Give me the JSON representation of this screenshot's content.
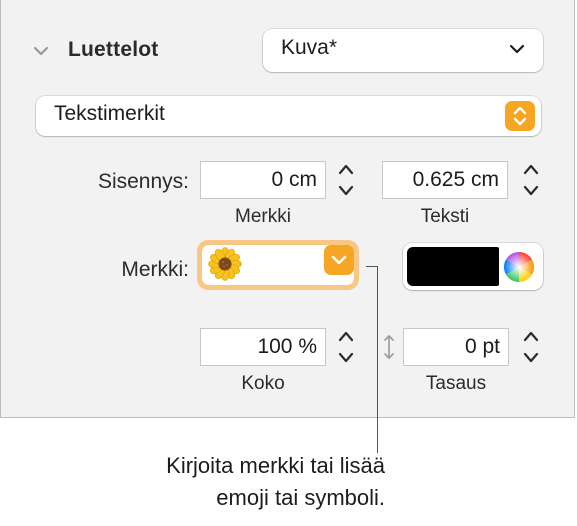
{
  "section": {
    "title": "Luettelot",
    "style_popup_value": "Kuva*"
  },
  "bullet_type": {
    "value": "Tekstimerkit"
  },
  "indent": {
    "label": "Sisennys:",
    "merkki_value": "0 cm",
    "merkki_sublabel": "Merkki",
    "teksti_value": "0.625 cm",
    "teksti_sublabel": "Teksti"
  },
  "bullet": {
    "label": "Merkki:",
    "character_icon": "sunflower-emoji",
    "color": "#000000"
  },
  "size": {
    "value": "100 %",
    "sublabel": "Koko"
  },
  "align": {
    "value": "0 pt",
    "sublabel": "Tasaus"
  },
  "callout": {
    "line1": "Kirjoita merkki tai lisää",
    "line2": "emoji tai symboli."
  },
  "colors": {
    "accent": "#f5a623",
    "focus_ring": "#f9c785",
    "panel_bg": "#f2f2f2"
  }
}
